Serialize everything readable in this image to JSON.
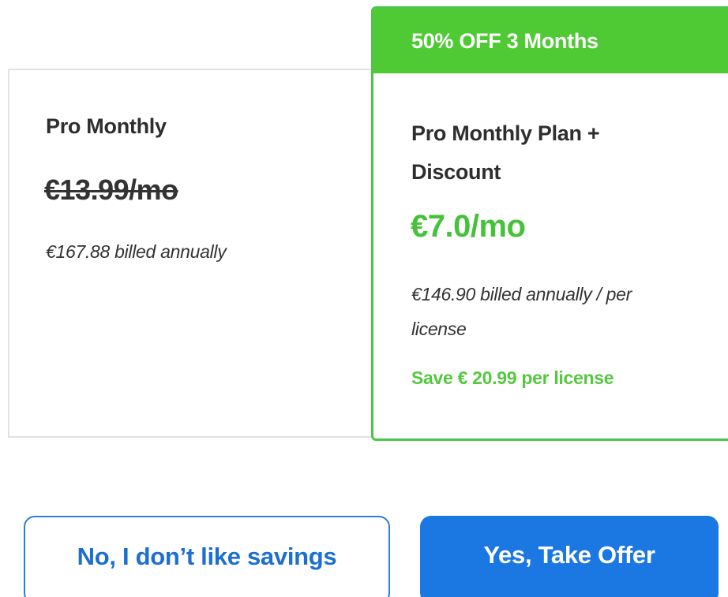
{
  "basic_plan": {
    "name": "Pro Monthly",
    "original_price": "€13.99/mo",
    "billing": "€167.88 billed annually"
  },
  "offer_plan": {
    "banner": "50% OFF 3 Months",
    "name": "Pro Monthly Plan + Discount",
    "price": "€7.0/mo",
    "billing": "€146.90 billed annually / per license",
    "savings": "Save € 20.99 per license"
  },
  "actions": {
    "decline_label": "No, I don’t like savings",
    "accept_label": "Yes, Take Offer"
  },
  "colors": {
    "accent_green": "#4fca35",
    "price_green": "#45c23a",
    "button_blue": "#1b78e2",
    "decline_text_blue": "#1d6fcf"
  }
}
